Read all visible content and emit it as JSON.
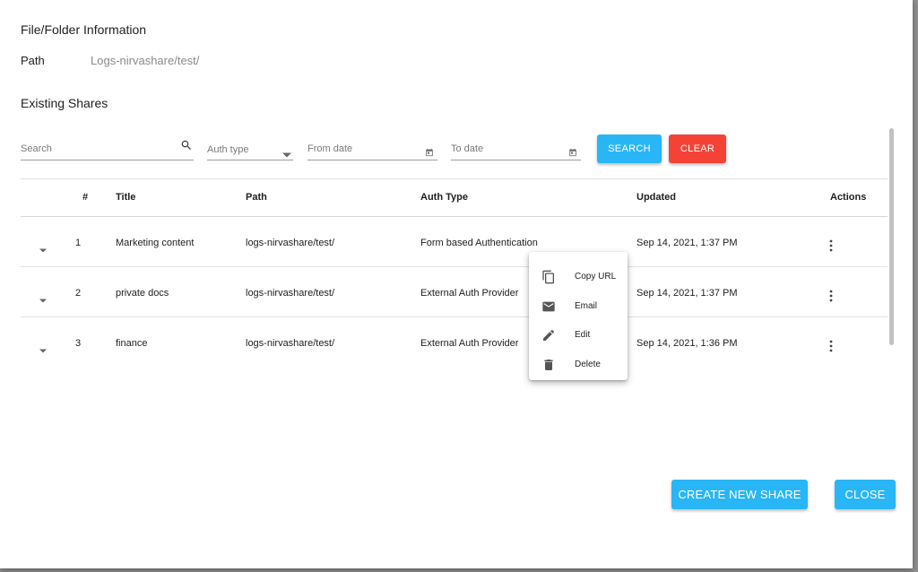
{
  "dialog": {
    "title": "File/Folder Information",
    "path_label": "Path",
    "path_value": "Logs-nirvashare/test/",
    "existing_shares_title": "Existing Shares"
  },
  "filters": {
    "search_placeholder": "Search",
    "auth_type_placeholder": "Auth type",
    "from_date_placeholder": "From date",
    "to_date_placeholder": "To date",
    "search_button": "SEARCH",
    "clear_button": "CLEAR"
  },
  "table": {
    "headers": [
      "#",
      "Title",
      "Path",
      "Auth Type",
      "Updated",
      "Actions"
    ],
    "rows": [
      {
        "num": "1",
        "title": "Marketing content",
        "path": "logs-nirvashare/test/",
        "auth": "Form based Authentication",
        "updated": "Sep 14, 2021, 1:37 PM"
      },
      {
        "num": "2",
        "title": "private docs",
        "path": "logs-nirvashare/test/",
        "auth": "External Auth Provider",
        "updated": "Sep 14, 2021, 1:37 PM"
      },
      {
        "num": "3",
        "title": "finance",
        "path": "logs-nirvashare/test/",
        "auth": "External Auth Provider",
        "updated": "Sep 14, 2021, 1:36 PM"
      }
    ]
  },
  "context_menu": {
    "items": [
      {
        "label": "Copy URL",
        "icon": "copy-icon"
      },
      {
        "label": "Email",
        "icon": "email-icon"
      },
      {
        "label": "Edit",
        "icon": "edit-icon"
      },
      {
        "label": "Delete",
        "icon": "delete-icon"
      }
    ]
  },
  "footer": {
    "create_button": "CREATE NEW SHARE",
    "close_button": "CLOSE"
  },
  "colors": {
    "primary": "#29b6f6",
    "danger": "#f44336"
  }
}
